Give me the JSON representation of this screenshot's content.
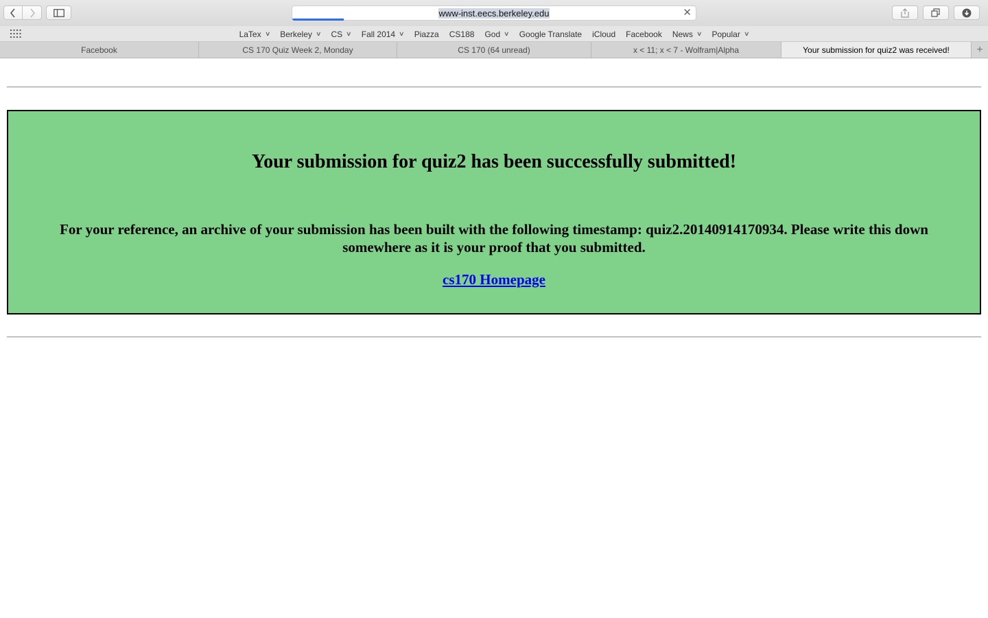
{
  "browser": {
    "address": "www-inst.eecs.berkeley.edu",
    "favorites": [
      {
        "label": "LaTex",
        "menu": true
      },
      {
        "label": "Berkeley",
        "menu": true
      },
      {
        "label": "CS",
        "menu": true
      },
      {
        "label": "Fall 2014",
        "menu": true
      },
      {
        "label": "Piazza",
        "menu": false
      },
      {
        "label": "CS188",
        "menu": false
      },
      {
        "label": "God",
        "menu": true
      },
      {
        "label": "Google Translate",
        "menu": false
      },
      {
        "label": "iCloud",
        "menu": false
      },
      {
        "label": "Facebook",
        "menu": false
      },
      {
        "label": "News",
        "menu": true
      },
      {
        "label": "Popular",
        "menu": true
      }
    ],
    "tabs": [
      {
        "title": "Facebook",
        "active": false
      },
      {
        "title": "CS 170 Quiz Week 2, Monday",
        "active": false
      },
      {
        "title": "CS 170 (64 unread)",
        "active": false
      },
      {
        "title": "x < 11; x < 7 - Wolfram|Alpha",
        "active": false
      },
      {
        "title": "Your submission for quiz2 was received!",
        "active": true
      }
    ]
  },
  "page": {
    "heading": "Your submission for quiz2 has been successfully submitted!",
    "reference_text": "For your reference, an archive of your submission has been built with the following timestamp: quiz2.20140914170934. Please write this down somewhere as it is your proof that you submitted.",
    "homepage_link": "cs170 Homepage",
    "panel_color": "#80d28a"
  }
}
